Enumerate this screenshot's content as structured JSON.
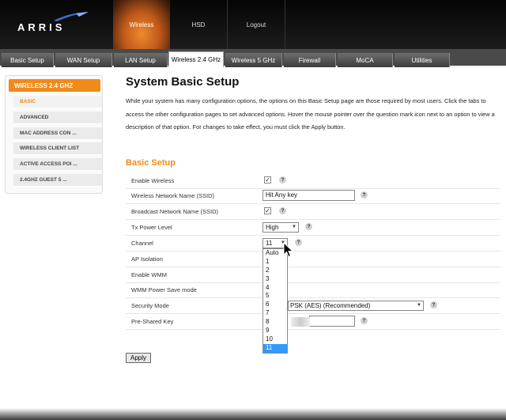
{
  "brand": {
    "logo_text": "ARRIS"
  },
  "topnav": {
    "items": [
      "Wireless",
      "HSD",
      "Logout"
    ],
    "active": "Wireless"
  },
  "tabs": [
    "Basic Setup",
    "WAN Setup",
    "LAN Setup",
    "Wireless 2.4 GHz",
    "Wireless 5 GHz",
    "Firewall",
    "MoCA",
    "Utilities"
  ],
  "sidebar": {
    "header": "WIRELESS 2.4 GHZ",
    "items": [
      "BASIC",
      "ADVANCED",
      "MAC ADDRESS CON ...",
      "WIRELESS CLIENT LIST",
      "ACTIVE ACCESS POI ...",
      "2.4GHZ GUEST 5 ..."
    ]
  },
  "page": {
    "title": "System Basic Setup",
    "description": "While your system has many configuration options, the options on this Basic Setup page are those required by most users. Click the tabs to access the other configuration pages to set advanced options. Hover the mouse pointer over the question mark icon next to an option to view a description of that option. For changes to take effect, you must click the Apply button.",
    "section": "Basic Setup"
  },
  "form": {
    "enable_wireless": {
      "label": "Enable Wireless",
      "checked": true
    },
    "ssid": {
      "label": "Wireless Network Name (SSID)",
      "value": "Hit Any key"
    },
    "broadcast_ssid": {
      "label": "Broadcast Network Name (SSID)",
      "checked": true
    },
    "tx_power": {
      "label": "Tx Power Level",
      "value": "High"
    },
    "channel": {
      "label": "Channel",
      "value": "11"
    },
    "ap_isolation": {
      "label": "AP Isolation"
    },
    "enable_wmm": {
      "label": "Enable WMM"
    },
    "wmm_power_save": {
      "label": "WMM Power Save mode"
    },
    "security_mode": {
      "label": "Security Mode",
      "value": "PSK (AES) (Recommended)"
    },
    "pre_shared_key": {
      "label": "Pre-Shared Key"
    },
    "checkmark": "✓",
    "help_symbol": "?"
  },
  "apply_label": "Apply",
  "channel_dropdown": {
    "options": [
      "Auto",
      "1",
      "2",
      "3",
      "4",
      "5",
      "6",
      "7",
      "8",
      "9",
      "10",
      "11"
    ],
    "selected": "11"
  },
  "colors": {
    "accent": "#f08a1a",
    "selection": "#3399ff"
  },
  "icons": {
    "help": "help-icon",
    "cursor": "mouse-pointer-icon",
    "logo_mark": "arris-swoosh-icon"
  }
}
